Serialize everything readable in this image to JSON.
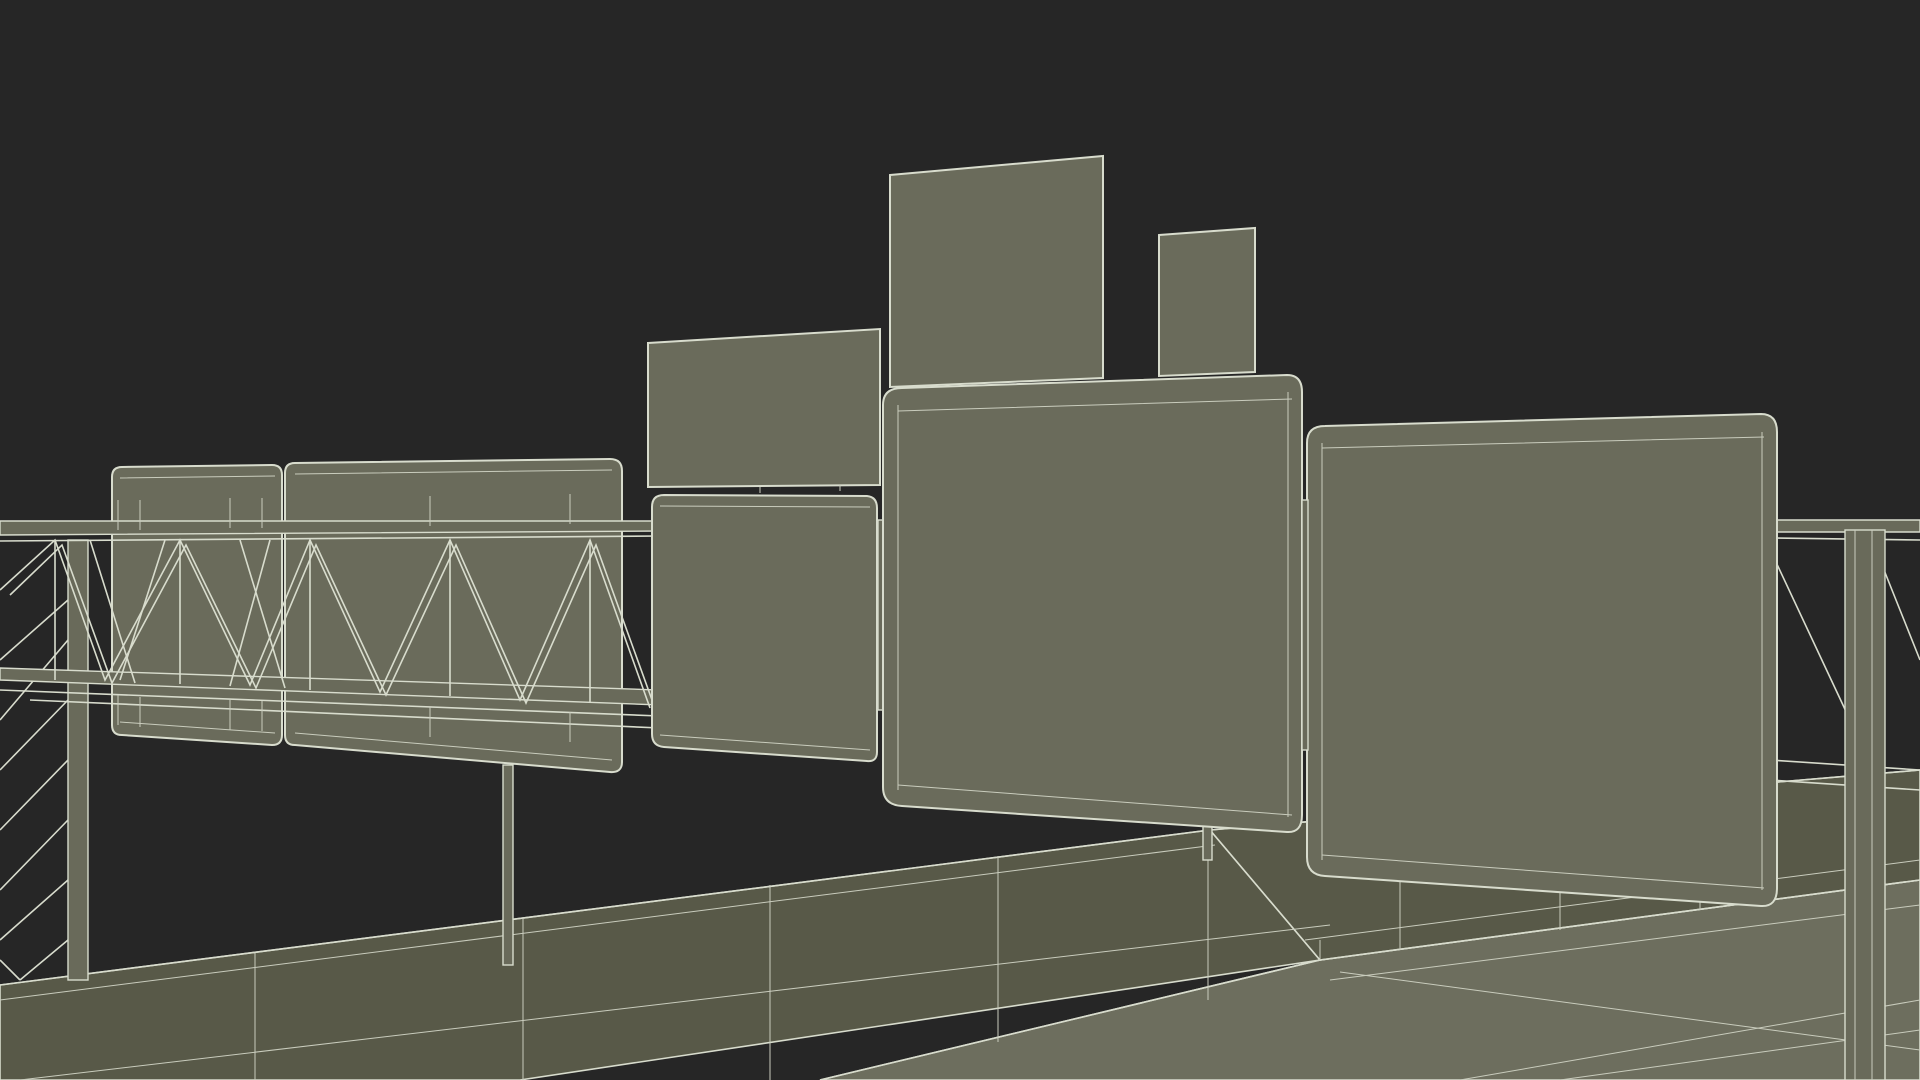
{
  "scene": {
    "subject": "highway-overhead-sign-gantry-wireframe",
    "colors": {
      "background": "#262626",
      "panel_fill": "#6a6b5b",
      "panel_shade": "#5f604f",
      "barrier_fill": "#585948",
      "road_fill": "#6d6e5e",
      "wire": "#d8dccd",
      "wire_dim": "#a6a997"
    }
  }
}
